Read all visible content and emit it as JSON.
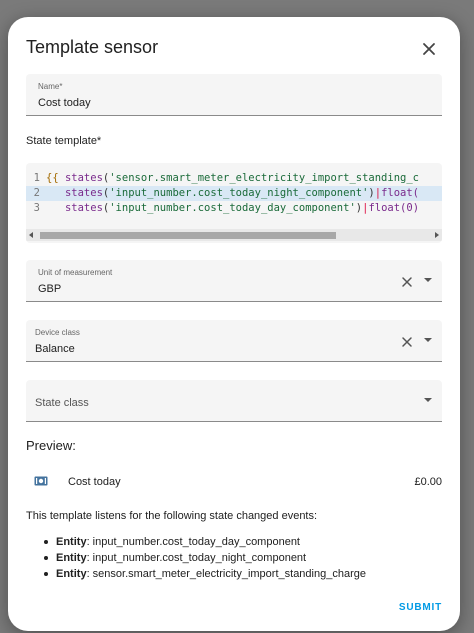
{
  "dialog": {
    "title": "Template sensor",
    "close_icon": "close-icon"
  },
  "name_field": {
    "label": "Name*",
    "value": "Cost today"
  },
  "state_template": {
    "label": "State template*",
    "lines": [
      {
        "num": "1",
        "tokens": [
          {
            "t": "{{ ",
            "c": "brace"
          },
          {
            "t": "states",
            "c": "fn"
          },
          {
            "t": "(",
            "c": "plain"
          },
          {
            "t": "'sensor.smart_meter_electricity_import_standing_c",
            "c": "str"
          }
        ]
      },
      {
        "num": "2",
        "tokens": [
          {
            "t": "   ",
            "c": "plain"
          },
          {
            "t": "states",
            "c": "fn"
          },
          {
            "t": "(",
            "c": "plain"
          },
          {
            "t": "'input_number.cost_today_night_component'",
            "c": "str"
          },
          {
            "t": ")",
            "c": "plain"
          },
          {
            "t": "|",
            "c": "pipe"
          },
          {
            "t": "float(",
            "c": "fn"
          }
        ]
      },
      {
        "num": "3",
        "tokens": [
          {
            "t": "   ",
            "c": "plain"
          },
          {
            "t": "states",
            "c": "fn"
          },
          {
            "t": "(",
            "c": "plain"
          },
          {
            "t": "'input_number.cost_today_day_component'",
            "c": "str"
          },
          {
            "t": ")",
            "c": "plain"
          },
          {
            "t": "|",
            "c": "pipe"
          },
          {
            "t": "float(0)",
            "c": "fn"
          }
        ]
      }
    ]
  },
  "unit_field": {
    "label": "Unit of measurement",
    "value": "GBP"
  },
  "device_class_field": {
    "label": "Device class",
    "value": "Balance"
  },
  "state_class_field": {
    "placeholder": "State class"
  },
  "preview": {
    "label": "Preview:",
    "icon": "cash-icon",
    "name": "Cost today",
    "value": "£0.00"
  },
  "listen": {
    "text": "This template listens for the following state changed events:",
    "events": [
      {
        "prefix": "Entity",
        "entity": ": input_number.cost_today_day_component"
      },
      {
        "prefix": "Entity",
        "entity": ": input_number.cost_today_night_component"
      },
      {
        "prefix": "Entity",
        "entity": ": sensor.smart_meter_electricity_import_standing_charge"
      }
    ]
  },
  "actions": {
    "submit_label": "SUBMIT"
  },
  "colors": {
    "accent": "#039be5",
    "backdrop": "#7a7a7a"
  }
}
